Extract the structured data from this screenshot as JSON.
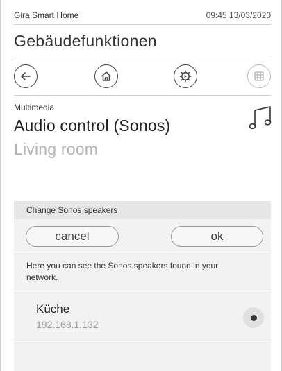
{
  "statusbar": {
    "app_name": "Gira Smart Home",
    "datetime": "09:45 13/03/2020"
  },
  "header": {
    "title": "Gebäudefunktionen"
  },
  "nav": {
    "buttons": [
      {
        "name": "back-button",
        "icon": "arrow-left-icon",
        "enabled": true
      },
      {
        "name": "home-button",
        "icon": "home-icon",
        "enabled": true
      },
      {
        "name": "settings-button",
        "icon": "gear-icon",
        "enabled": true
      },
      {
        "name": "grid-button",
        "icon": "grid-icon",
        "enabled": false
      }
    ]
  },
  "device": {
    "category": "Multimedia",
    "title": "Audio control (Sonos)",
    "room": "Living room",
    "icon": "music-note-icon"
  },
  "dialog": {
    "title": "Change Sonos speakers",
    "cancel_label": "cancel",
    "ok_label": "ok",
    "info": "Here you can see the Sonos speakers found in your network.",
    "speakers": [
      {
        "name": "Küche",
        "ip": "192.168.1.132",
        "selected": true
      }
    ]
  },
  "colors": {
    "text": "#333333",
    "muted": "#b3b3b3",
    "dialog_bg": "#f2f2f2",
    "dialog_header": "#e6e6e6"
  }
}
